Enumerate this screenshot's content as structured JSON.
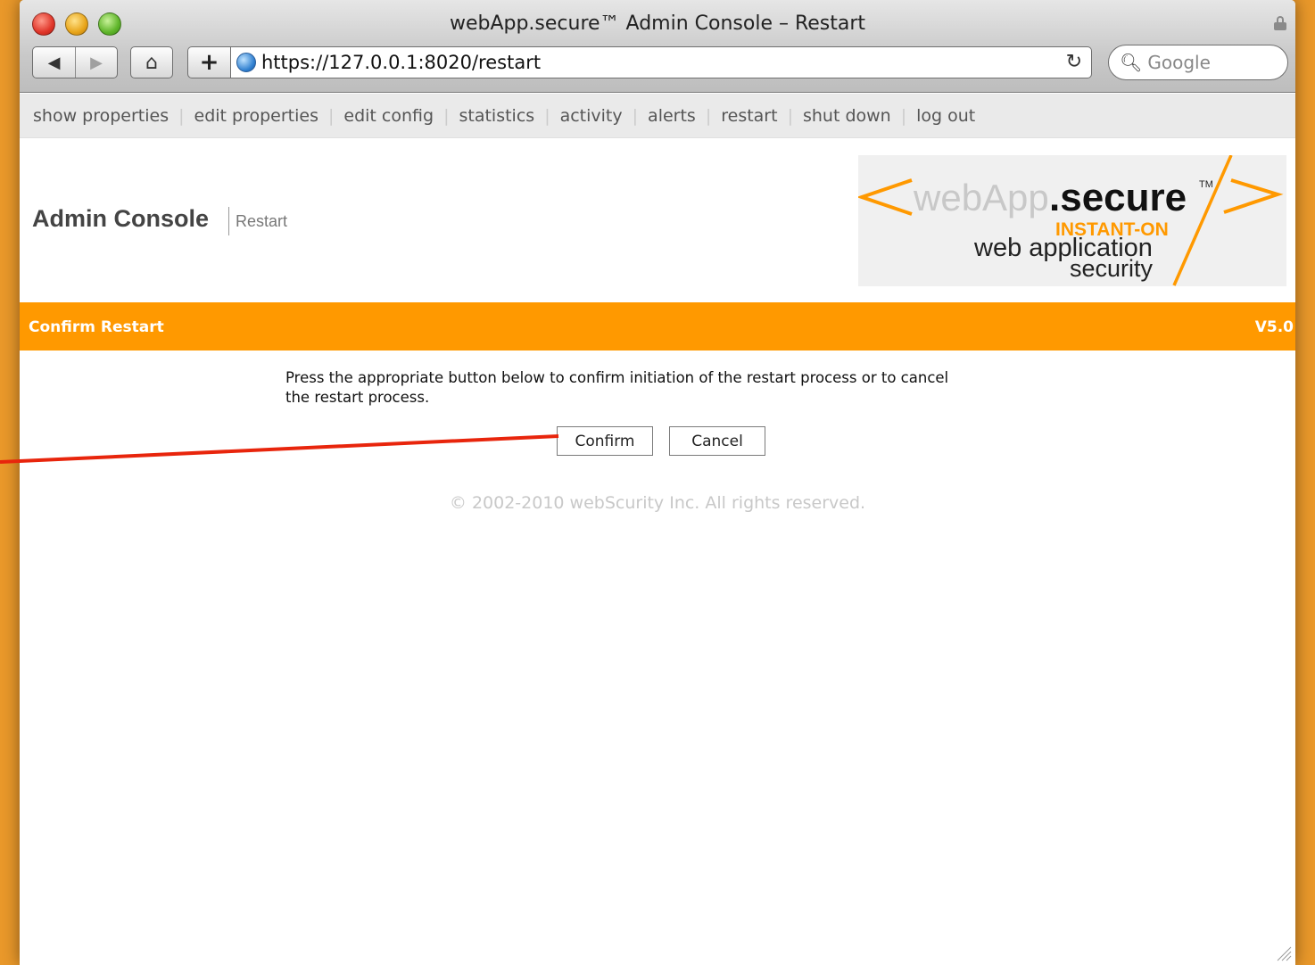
{
  "window": {
    "title": "webApp.secure™ Admin Console – Restart"
  },
  "toolbar": {
    "back_icon": "back-arrow-icon",
    "forward_icon": "forward-arrow-icon",
    "home_icon": "home-icon",
    "add_icon": "add-bookmark-icon",
    "url": "https://127.0.0.1:8020/restart",
    "search_placeholder": "Google"
  },
  "nav": {
    "items": [
      {
        "label": "show properties"
      },
      {
        "label": "edit properties"
      },
      {
        "label": "edit config"
      },
      {
        "label": "statistics"
      },
      {
        "label": "activity"
      },
      {
        "label": "alerts"
      },
      {
        "label": "restart"
      },
      {
        "label": "shut down"
      },
      {
        "label": "log out"
      }
    ]
  },
  "header": {
    "title": "Admin Console",
    "subtitle": "Restart",
    "logo": {
      "brand": "webApp",
      "brand_bold": ".secure",
      "tm": "TM",
      "tagline": "INSTANT-ON",
      "line1": "web application",
      "line2": "security"
    }
  },
  "bar": {
    "title": "Confirm Restart",
    "version": "V5.0"
  },
  "content": {
    "message_line1": "Press the appropriate button below to confirm initiation of the restart process or to cancel",
    "message_line2": "the restart process.",
    "confirm_label": "Confirm",
    "cancel_label": "Cancel",
    "copyright": "© 2002-2010 webScurity Inc. All rights reserved."
  },
  "colors": {
    "background": "#e9982a",
    "accent": "#ff9900",
    "annotation": "#e8250c"
  }
}
